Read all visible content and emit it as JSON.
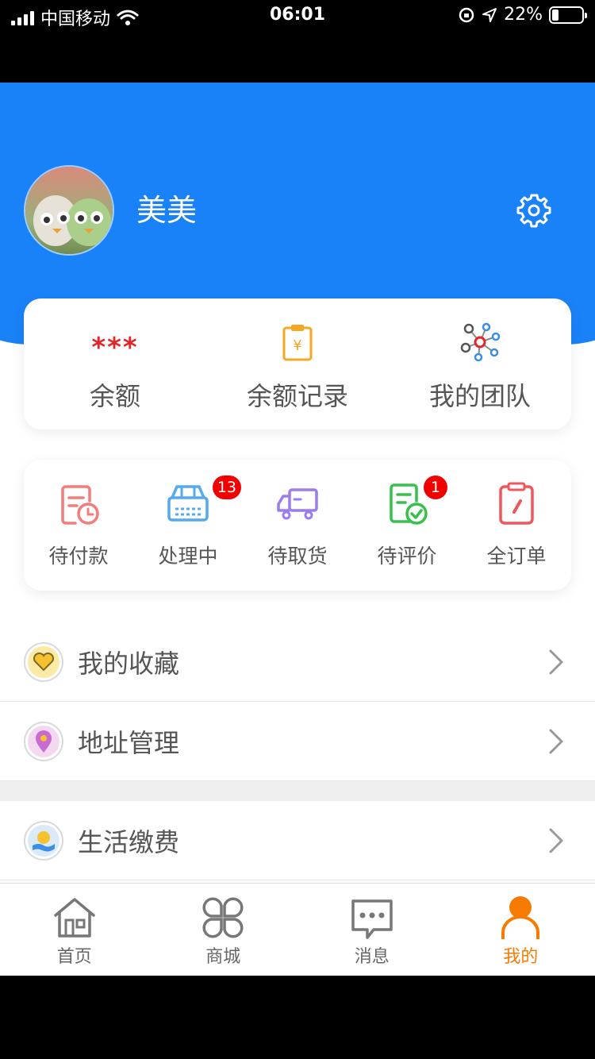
{
  "status_bar": {
    "carrier": "中国移动",
    "time": "06:01",
    "battery": "22%"
  },
  "profile": {
    "username": "美美"
  },
  "balance_card": {
    "balance_value": "***",
    "items": [
      {
        "label": "余额"
      },
      {
        "label": "余额记录"
      },
      {
        "label": "我的团队"
      }
    ]
  },
  "orders": [
    {
      "label": "待付款",
      "badge": ""
    },
    {
      "label": "处理中",
      "badge": "13"
    },
    {
      "label": "待取货",
      "badge": ""
    },
    {
      "label": "待评价",
      "badge": "1"
    },
    {
      "label": "全订单",
      "badge": ""
    }
  ],
  "menu": [
    {
      "label": "我的收藏"
    },
    {
      "label": "地址管理"
    },
    {
      "label": "生活缴费"
    }
  ],
  "tabbar": [
    {
      "label": "首页"
    },
    {
      "label": "商城"
    },
    {
      "label": "消息"
    },
    {
      "label": "我的"
    }
  ],
  "colors": {
    "brand_blue": "#1a82f8",
    "active_orange": "#f77b00",
    "badge_red": "#f20000"
  }
}
